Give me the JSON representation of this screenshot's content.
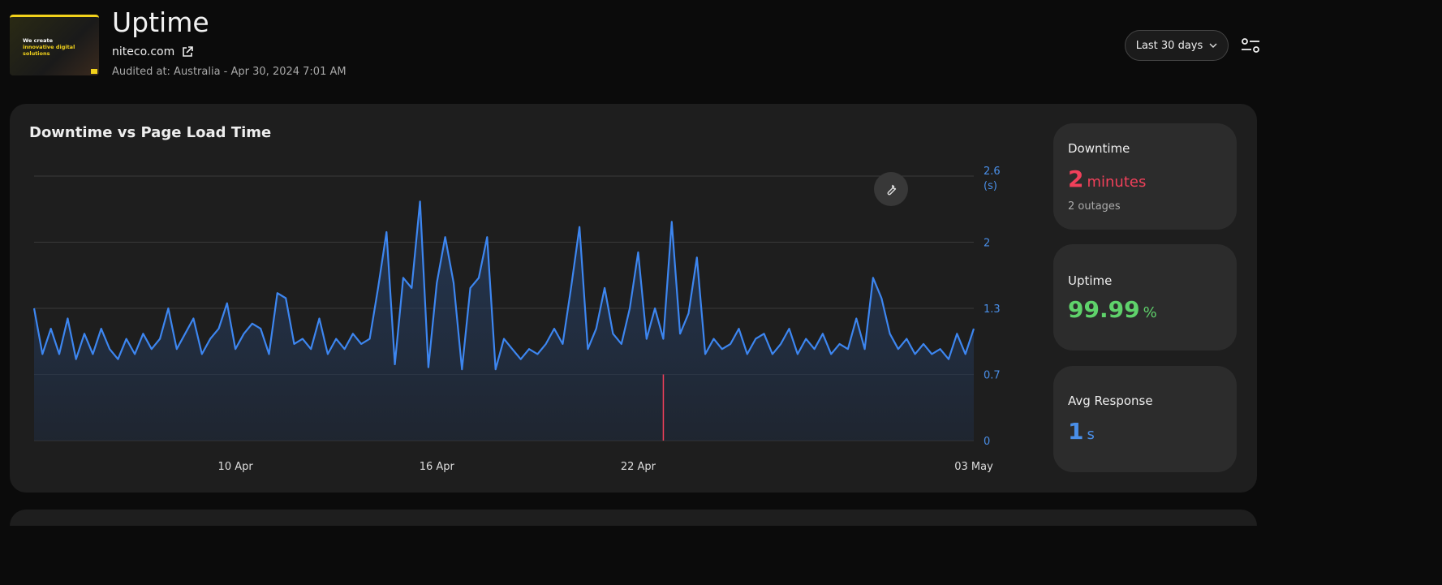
{
  "header": {
    "thumbnail": {
      "line1": "We create",
      "line2": "innovative digital solutions"
    },
    "title": "Uptime",
    "site": "niteco.com",
    "audited": "Audited at: Australia - Apr 30, 2024 7:01 AM",
    "range_select": "Last 30 days",
    "icons": {
      "external": "external-link-icon",
      "dropdown": "chevron-down-icon",
      "filter": "sliders-icon"
    }
  },
  "card": {
    "title": "Downtime vs Page Load Time",
    "wrench_icon": "wrench-icon"
  },
  "stats": [
    {
      "label": "Downtime",
      "value": "2",
      "unit": "minutes",
      "sub": "2 outages",
      "color": "#f0405a"
    },
    {
      "label": "Uptime",
      "value": "99.99",
      "unit": "%",
      "color": "#5fd26b"
    },
    {
      "label": "Avg Response",
      "value": "1",
      "unit": "s",
      "color": "#4a8fe8"
    }
  ],
  "chart_data": {
    "type": "area",
    "ylabel_unit": "(s)",
    "ylim": [
      0,
      2.6
    ],
    "yticks": [
      "0",
      "0.7",
      "1.3",
      "2",
      "2.6"
    ],
    "ytick_values": [
      0,
      0.65,
      1.3,
      1.95,
      2.6
    ],
    "xticks": [
      {
        "label": "10 Apr",
        "at": "2024-04-10T00:00"
      },
      {
        "label": "16 Apr",
        "at": "2024-04-16T00:00"
      },
      {
        "label": "22 Apr",
        "at": "2024-04-22T00:00"
      },
      {
        "label": "03 May",
        "at": "2024-05-02T00:00"
      }
    ],
    "grid": true,
    "line_color": "#3d86f0",
    "downtime_color": "#f0405a",
    "downtime_events": [
      "2024-04-22T18:00"
    ],
    "series": [
      {
        "x": [
          "2024-04-04T00:00",
          "2024-04-04T06:00",
          "2024-04-04T12:00",
          "2024-04-04T18:00",
          "2024-04-05T00:00",
          "2024-04-05T06:00",
          "2024-04-05T12:00",
          "2024-04-05T18:00",
          "2024-04-06T00:00",
          "2024-04-06T06:00",
          "2024-04-06T12:00",
          "2024-04-06T18:00",
          "2024-04-07T00:00",
          "2024-04-07T06:00",
          "2024-04-07T12:00",
          "2024-04-07T18:00",
          "2024-04-08T00:00",
          "2024-04-08T06:00",
          "2024-04-08T12:00",
          "2024-04-08T18:00",
          "2024-04-09T00:00",
          "2024-04-09T06:00",
          "2024-04-09T12:00",
          "2024-04-09T18:00",
          "2024-04-10T00:00",
          "2024-04-10T06:00",
          "2024-04-10T12:00",
          "2024-04-10T18:00",
          "2024-04-11T00:00",
          "2024-04-11T06:00",
          "2024-04-11T12:00",
          "2024-04-11T18:00",
          "2024-04-12T00:00",
          "2024-04-12T06:00",
          "2024-04-12T12:00",
          "2024-04-12T18:00",
          "2024-04-13T00:00",
          "2024-04-13T06:00",
          "2024-04-13T12:00",
          "2024-04-13T18:00",
          "2024-04-14T00:00",
          "2024-04-14T06:00",
          "2024-04-14T12:00",
          "2024-04-14T18:00",
          "2024-04-15T00:00",
          "2024-04-15T06:00",
          "2024-04-15T12:00",
          "2024-04-15T18:00",
          "2024-04-16T00:00",
          "2024-04-16T06:00",
          "2024-04-16T12:00",
          "2024-04-16T18:00",
          "2024-04-17T00:00",
          "2024-04-17T06:00",
          "2024-04-17T12:00",
          "2024-04-17T18:00",
          "2024-04-18T00:00",
          "2024-04-18T06:00",
          "2024-04-18T12:00",
          "2024-04-18T18:00",
          "2024-04-19T00:00",
          "2024-04-19T06:00",
          "2024-04-19T12:00",
          "2024-04-19T18:00",
          "2024-04-20T00:00",
          "2024-04-20T06:00",
          "2024-04-20T12:00",
          "2024-04-20T18:00",
          "2024-04-21T00:00",
          "2024-04-21T06:00",
          "2024-04-21T12:00",
          "2024-04-21T18:00",
          "2024-04-22T00:00",
          "2024-04-22T06:00",
          "2024-04-22T12:00",
          "2024-04-22T18:00",
          "2024-04-23T00:00",
          "2024-04-23T06:00",
          "2024-04-23T12:00",
          "2024-04-23T18:00",
          "2024-04-24T00:00",
          "2024-04-24T06:00",
          "2024-04-24T12:00",
          "2024-04-24T18:00",
          "2024-04-25T00:00",
          "2024-04-25T06:00",
          "2024-04-25T12:00",
          "2024-04-25T18:00",
          "2024-04-26T00:00",
          "2024-04-26T06:00",
          "2024-04-26T12:00",
          "2024-04-26T18:00",
          "2024-04-27T00:00",
          "2024-04-27T06:00",
          "2024-04-27T12:00",
          "2024-04-27T18:00",
          "2024-04-28T00:00",
          "2024-04-28T06:00",
          "2024-04-28T12:00",
          "2024-04-28T18:00",
          "2024-04-29T00:00",
          "2024-04-29T06:00",
          "2024-04-29T12:00",
          "2024-04-29T18:00",
          "2024-04-30T00:00",
          "2024-04-30T06:00",
          "2024-04-30T12:00",
          "2024-04-30T18:00",
          "2024-05-01T00:00",
          "2024-05-01T06:00",
          "2024-05-01T12:00",
          "2024-05-01T18:00",
          "2024-05-02T00:00"
        ],
        "values": [
          1.3,
          0.85,
          1.1,
          0.85,
          1.2,
          0.8,
          1.05,
          0.85,
          1.1,
          0.9,
          0.8,
          1.0,
          0.85,
          1.05,
          0.9,
          1.0,
          1.3,
          0.9,
          1.05,
          1.2,
          0.85,
          1.0,
          1.1,
          1.35,
          0.9,
          1.05,
          1.15,
          1.1,
          0.85,
          1.45,
          1.4,
          0.95,
          1.0,
          0.9,
          1.2,
          0.85,
          1.0,
          0.9,
          1.05,
          0.95,
          1.0,
          1.5,
          2.05,
          0.75,
          1.6,
          1.5,
          2.35,
          0.72,
          1.55,
          2.0,
          1.55,
          0.7,
          1.5,
          1.6,
          2.0,
          0.7,
          1.0,
          0.9,
          0.8,
          0.9,
          0.85,
          0.95,
          1.1,
          0.95,
          1.5,
          2.1,
          0.9,
          1.1,
          1.5,
          1.05,
          0.95,
          1.3,
          1.85,
          1.0,
          1.3,
          1.0,
          2.15,
          1.05,
          1.25,
          1.8,
          0.85,
          1.0,
          0.9,
          0.95,
          1.1,
          0.85,
          1.0,
          1.05,
          0.85,
          0.95,
          1.1,
          0.85,
          1.0,
          0.9,
          1.05,
          0.85,
          0.95,
          0.9,
          1.2,
          0.9,
          1.6,
          1.4,
          1.05,
          0.9,
          1.0,
          0.85,
          0.95,
          0.85,
          0.9,
          0.8,
          1.05,
          0.85,
          1.1
        ]
      }
    ]
  }
}
